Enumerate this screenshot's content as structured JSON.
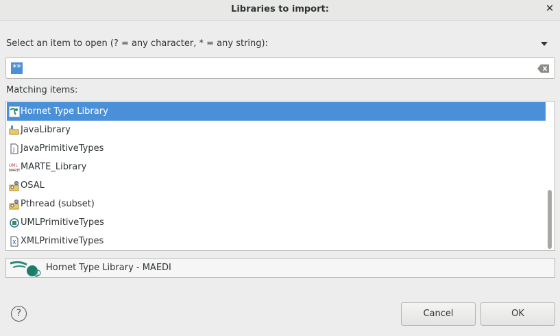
{
  "window": {
    "title": "Libraries to import:"
  },
  "search": {
    "prompt": "Select an item to open (? = any character, * = any string):",
    "value": "**"
  },
  "list": {
    "label": "Matching items:",
    "items": [
      {
        "label": "Hornet Type Library",
        "icon": "hornet-library-icon",
        "selected": true
      },
      {
        "label": "JavaLibrary",
        "icon": "folder-library-icon",
        "selected": false
      },
      {
        "label": "JavaPrimitiveTypes",
        "icon": "java-file-icon",
        "selected": false
      },
      {
        "label": "MARTE_Library",
        "icon": "uml-marte-icon",
        "selected": false
      },
      {
        "label": "OSAL",
        "icon": "package-library-icon",
        "selected": false
      },
      {
        "label": "Pthread (subset)",
        "icon": "package-library-icon",
        "selected": false
      },
      {
        "label": "UMLPrimitiveTypes",
        "icon": "uml-package-icon",
        "selected": false
      },
      {
        "label": "XMLPrimitiveTypes",
        "icon": "xml-file-icon",
        "selected": false
      }
    ]
  },
  "detail": {
    "label": "Hornet Type Library - MAEDI",
    "icon": "hornet-logo-icon"
  },
  "buttons": {
    "cancel": "Cancel",
    "ok": "OK",
    "help": "?"
  },
  "colors": {
    "selection": "#4a90d9",
    "background": "#ededed"
  }
}
